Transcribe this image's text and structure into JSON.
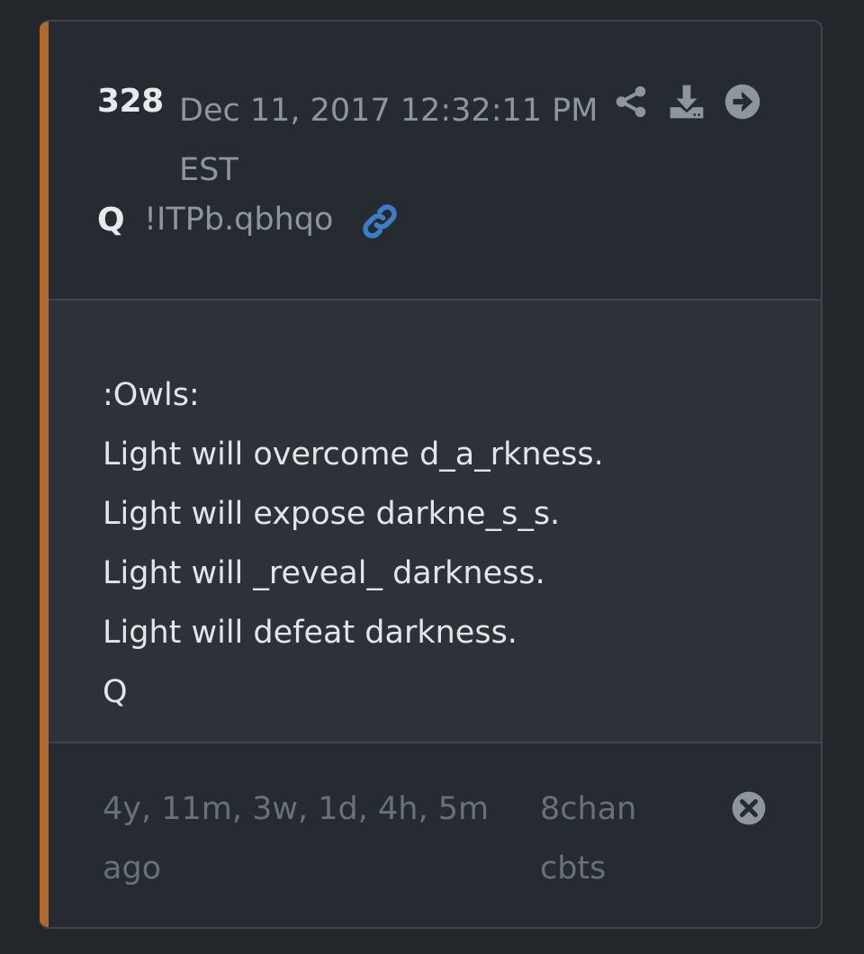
{
  "post": {
    "number": "328",
    "date": "Dec 11, 2017 12:32:11 PM EST",
    "author": "Q",
    "tripcode": "!ITPb.qbhqo",
    "body_lines": [
      ":Owls:",
      "Light will overcome d_a_rkness.",
      "Light will expose darkne_s_s.",
      "Light will _reveal_ darkness.",
      "Light will defeat darkness.",
      "Q"
    ],
    "relative_time": "4y, 11m, 3w, 1d, 4h, 5m ago",
    "board": "8chan cbts"
  },
  "icons": {
    "share": "share-icon",
    "download": "download-icon",
    "goto": "arrow-right-circle-icon",
    "permalink": "link-icon",
    "close": "close-circle-icon"
  },
  "colors": {
    "accent": "#b4692a",
    "link": "#3a7fc4",
    "background": "#23272c",
    "card": "#262b32",
    "body_panel": "#2d3239"
  }
}
